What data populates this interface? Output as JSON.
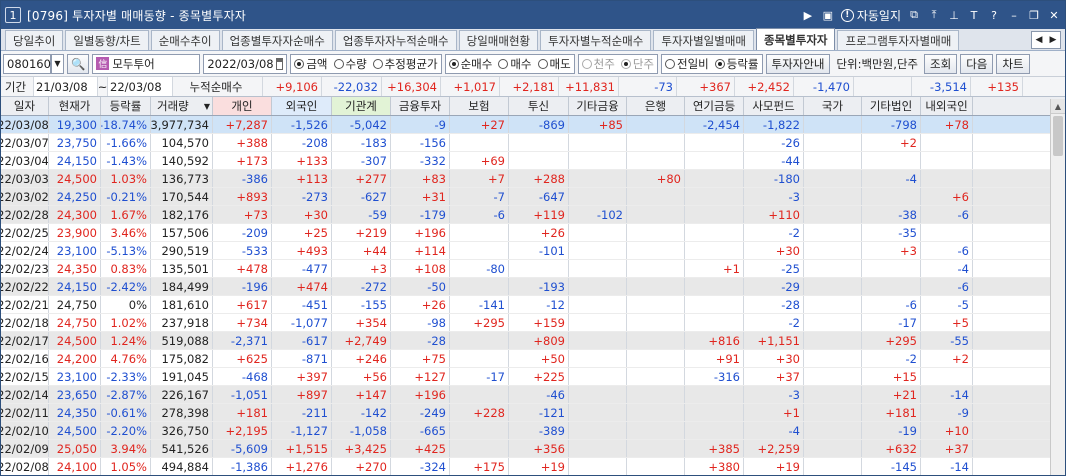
{
  "window": {
    "num": "1",
    "title": "[0796] 투자자별 매매동향 - 종목별투자자",
    "dday_label": "자동일지"
  },
  "tabs": [
    "당일추이",
    "일별동향/차트",
    "순매수추이",
    "업종별투자자순매수",
    "업종투자자누적순매수",
    "당일매매현황",
    "투자자별누적순매수",
    "투자자별일별매매",
    "종목별투자자",
    "프로그램투자자별매매"
  ],
  "active_tab": 8,
  "controls": {
    "code": "080160",
    "stock_name": "모두투어",
    "date": "2022/03/08",
    "unit": "단위:백만원,단주",
    "grp1": [
      "금액",
      "수량",
      "추정평균가"
    ],
    "grp2": [
      "순매수",
      "매수",
      "매도"
    ],
    "grp3": [
      "천주",
      "단주"
    ],
    "grp4": [
      "전일비",
      "등락률"
    ],
    "btn_guide": "투자자안내",
    "btn_query": "조회",
    "btn_next": "다음",
    "btn_chart": "차트"
  },
  "summary": {
    "label": "기간",
    "from": "21/03/08",
    "tilde": "~",
    "to": "22/03/08",
    "title": "누적순매수",
    "values": [
      "+9,106",
      "-22,032",
      "+16,304",
      "+1,017",
      "+2,181",
      "+11,831",
      "-73",
      "+367",
      "+2,452",
      "-1,470",
      "",
      "-3,514",
      "+135"
    ]
  },
  "headers": [
    "일자",
    "현재가",
    "등락률",
    "거래량",
    "개인",
    "외국인",
    "기관계",
    "금융투자",
    "보험",
    "투신",
    "기타금융",
    "은행",
    "연기금등",
    "사모펀드",
    "국가",
    "기타법인",
    "내외국인"
  ],
  "rows": [
    [
      "22/03/08",
      "19,300",
      "-18.74%",
      "3,977,734",
      "+7,287",
      "-1,526",
      "-5,042",
      "-9",
      "+27",
      "-869",
      "+85",
      "",
      "-2,454",
      "-1,822",
      "",
      "-798",
      "+78"
    ],
    [
      "22/03/07",
      "23,750",
      "-1.66%",
      "104,570",
      "+388",
      "-208",
      "-183",
      "-156",
      "",
      "",
      "",
      "",
      "",
      "-26",
      "",
      "+2",
      ""
    ],
    [
      "22/03/04",
      "24,150",
      "-1.43%",
      "140,592",
      "+173",
      "+133",
      "-307",
      "-332",
      "+69",
      "",
      "",
      "",
      "",
      "-44",
      "",
      "",
      ""
    ],
    [
      "22/03/03",
      "24,500",
      "1.03%",
      "136,773",
      "-386",
      "+113",
      "+277",
      "+83",
      "+7",
      "+288",
      "",
      "+80",
      "",
      "-180",
      "",
      "-4",
      ""
    ],
    [
      "22/03/02",
      "24,250",
      "-0.21%",
      "170,544",
      "+893",
      "-273",
      "-627",
      "+31",
      "-7",
      "-647",
      "",
      "",
      "",
      "-3",
      "",
      "",
      "+6"
    ],
    [
      "22/02/28",
      "24,300",
      "1.67%",
      "182,176",
      "+73",
      "+30",
      "-59",
      "-179",
      "-6",
      "+119",
      "-102",
      "",
      "",
      "+110",
      "",
      "-38",
      "-6"
    ],
    [
      "22/02/25",
      "23,900",
      "3.46%",
      "157,506",
      "-209",
      "+25",
      "+219",
      "+196",
      "",
      "+26",
      "",
      "",
      "",
      "-2",
      "",
      "-35",
      ""
    ],
    [
      "22/02/24",
      "23,100",
      "-5.13%",
      "290,519",
      "-533",
      "+493",
      "+44",
      "+114",
      "",
      "-101",
      "",
      "",
      "",
      "+30",
      "",
      "+3",
      "-6"
    ],
    [
      "22/02/23",
      "24,350",
      "0.83%",
      "135,501",
      "+478",
      "-477",
      "+3",
      "+108",
      "-80",
      "",
      "",
      "",
      "+1",
      "-25",
      "",
      "",
      "-4"
    ],
    [
      "22/02/22",
      "24,150",
      "-2.42%",
      "184,499",
      "-196",
      "+474",
      "-272",
      "-50",
      "",
      "-193",
      "",
      "",
      "",
      "-29",
      "",
      "",
      "-6"
    ],
    [
      "22/02/21",
      "24,750",
      "0%",
      "181,610",
      "+617",
      "-451",
      "-155",
      "+26",
      "-141",
      "-12",
      "",
      "",
      "",
      "-28",
      "",
      "-6",
      "-5"
    ],
    [
      "22/02/18",
      "24,750",
      "1.02%",
      "237,918",
      "+734",
      "-1,077",
      "+354",
      "-98",
      "+295",
      "+159",
      "",
      "",
      "",
      "-2",
      "",
      "-17",
      "+5"
    ],
    [
      "22/02/17",
      "24,500",
      "1.24%",
      "519,088",
      "-2,371",
      "-617",
      "+2,749",
      "-28",
      "",
      "+809",
      "",
      "",
      "+816",
      "+1,151",
      "",
      "+295",
      "-55"
    ],
    [
      "22/02/16",
      "24,200",
      "4.76%",
      "175,082",
      "+625",
      "-871",
      "+246",
      "+75",
      "",
      "+50",
      "",
      "",
      "+91",
      "+30",
      "",
      "-2",
      "+2"
    ],
    [
      "22/02/15",
      "23,100",
      "-2.33%",
      "191,045",
      "-468",
      "+397",
      "+56",
      "+127",
      "-17",
      "+225",
      "",
      "",
      "-316",
      "+37",
      "",
      "+15",
      ""
    ],
    [
      "22/02/14",
      "23,650",
      "-2.87%",
      "226,167",
      "-1,051",
      "+897",
      "+147",
      "+196",
      "",
      "-46",
      "",
      "",
      "",
      "-3",
      "",
      "+21",
      "-14"
    ],
    [
      "22/02/11",
      "24,350",
      "-0.61%",
      "278,398",
      "+181",
      "-211",
      "-142",
      "-249",
      "+228",
      "-121",
      "",
      "",
      "",
      "+1",
      "",
      "+181",
      "-9"
    ],
    [
      "22/02/10",
      "24,500",
      "-2.20%",
      "326,750",
      "+2,195",
      "-1,127",
      "-1,058",
      "-665",
      "",
      "-389",
      "",
      "",
      "",
      "-4",
      "",
      "-19",
      "+10"
    ],
    [
      "22/02/09",
      "25,050",
      "3.94%",
      "541,526",
      "-5,609",
      "+1,515",
      "+3,425",
      "+425",
      "",
      "+356",
      "",
      "",
      "+385",
      "+2,259",
      "",
      "+632",
      "+37"
    ],
    [
      "22/02/08",
      "24,100",
      "1.05%",
      "494,884",
      "-1,386",
      "+1,276",
      "+270",
      "-324",
      "+175",
      "+19",
      "",
      "",
      "+380",
      "+19",
      "",
      "-145",
      "-14"
    ]
  ],
  "row_shade": [
    "hl",
    "",
    "",
    "gr",
    "gr",
    "gr",
    "",
    "",
    "",
    "gr",
    "",
    "",
    "gr",
    "",
    "",
    "gr",
    "gr",
    "gr",
    "gr",
    ""
  ],
  "colors": {
    "up": "#e0251e",
    "down": "#1f4fd0",
    "title_bg": "#2f5489",
    "highlight": "#cfe3f7"
  }
}
